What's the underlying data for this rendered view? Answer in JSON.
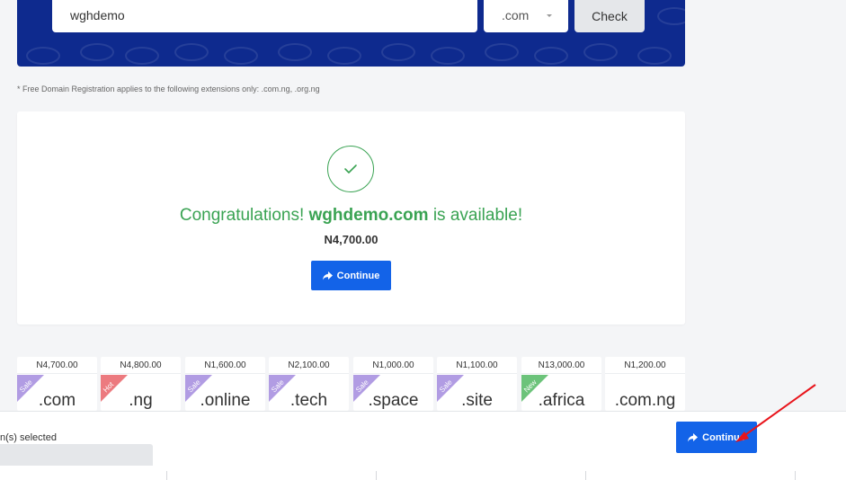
{
  "search": {
    "domain_value": "wghdemo",
    "tld_selected": ".com",
    "check_label": "Check"
  },
  "free_note": "* Free Domain Registration applies to the following extensions only: .com.ng, .org.ng",
  "result": {
    "congrats_prefix": "Congratulations!",
    "domain": "wghdemo.com",
    "congrats_suffix": "is available!",
    "price": "N4,700.00",
    "continue_label": "Continue"
  },
  "tlds": [
    {
      "price": "N4,700.00",
      "name": ".com",
      "badge": "Sale"
    },
    {
      "price": "N4,800.00",
      "name": ".ng",
      "badge": "Hot"
    },
    {
      "price": "N1,600.00",
      "name": ".online",
      "badge": "Sale"
    },
    {
      "price": "N2,100.00",
      "name": ".tech",
      "badge": "Sale"
    },
    {
      "price": "N1,000.00",
      "name": ".space",
      "badge": "Sale"
    },
    {
      "price": "N1,100.00",
      "name": ".site",
      "badge": "Sale"
    },
    {
      "price": "N13,000.00",
      "name": ".africa",
      "badge": "New"
    },
    {
      "price": "N1,200.00",
      "name": ".com.ng",
      "badge": ""
    }
  ],
  "bottom": {
    "selected_text": "n(s) selected",
    "continue_label": "Continue"
  },
  "colors": {
    "banner": "#0e2a8e",
    "accent": "#1363e8",
    "success": "#3aa353",
    "badge_sale": "#b19ce3",
    "badge_hot": "#ec7a7f",
    "badge_new": "#6cc37a",
    "annotation_arrow": "#e8141b"
  }
}
